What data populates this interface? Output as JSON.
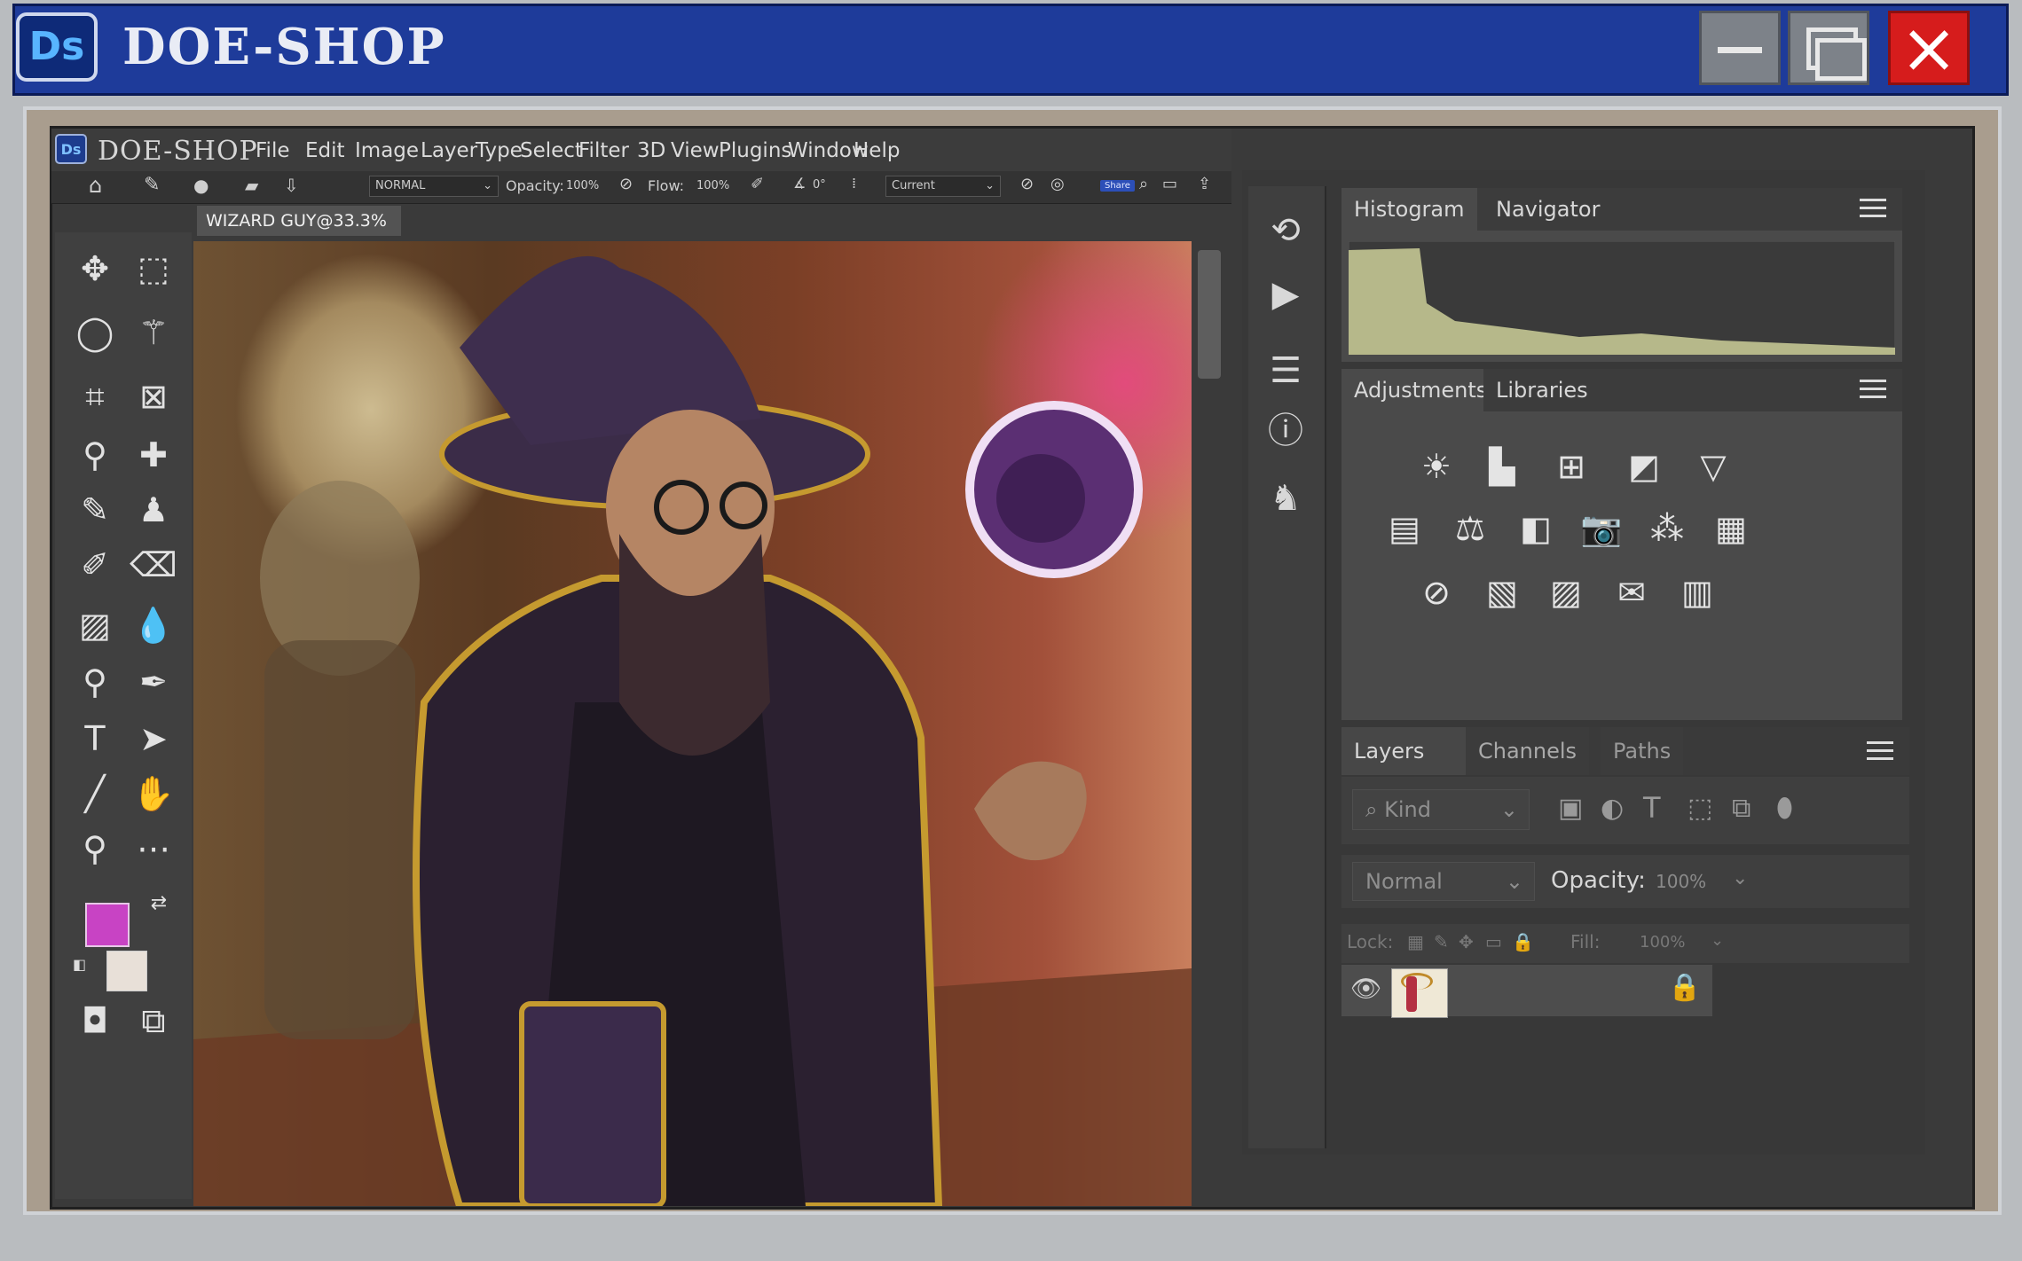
{
  "app": {
    "logo_text": "Ds",
    "title": "DOE-SHOP",
    "window_controls": {
      "minimize": "minimize-icon",
      "maximize": "maximize-icon",
      "close": "×"
    }
  },
  "menu": {
    "logo_text": "Ds",
    "title": "DOE-SHOP",
    "items": [
      "File",
      "Edit",
      "Image",
      "Layer",
      "Type",
      "Select",
      "Filter",
      "3D",
      "View",
      "Plugins",
      "Window",
      "Help"
    ]
  },
  "options": {
    "mode": "NORMAL",
    "opacity_label": "Opacity:",
    "opacity_value": "100%",
    "flow_label": "Flow:",
    "flow_value": "100%",
    "angle_value": "0°",
    "sample_value": "Current",
    "share_label": "Share"
  },
  "document": {
    "tab_title": "WIZARD GUY@33.3%"
  },
  "tools": {
    "fg_color": "#c843c4",
    "bg_color": "#e8e0d8"
  },
  "panels": {
    "top_tabs": [
      "Histogram",
      "Navigator"
    ],
    "mid_tabs": [
      "Adjustments",
      "Libraries"
    ],
    "layers_tabs": [
      "Layers",
      "Channels",
      "Paths"
    ],
    "kind_label": "Kind",
    "blend_mode": "Normal",
    "opacity_label": "Opacity:",
    "opacity_value": "100%",
    "lock_label": "Lock:",
    "fill_label": "Fill:",
    "fill_value": "100%"
  },
  "colors": {
    "title_bar": "#1e3b9a",
    "close_button": "#d61c1c",
    "histogram_fill": "#b6b88a",
    "foreground_swatch": "#c843c4"
  }
}
